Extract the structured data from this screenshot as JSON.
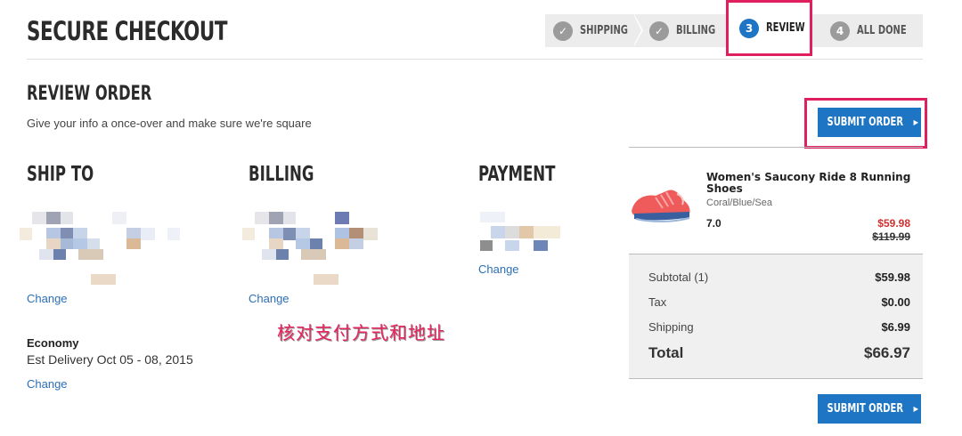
{
  "page": {
    "title": "SECURE CHECKOUT"
  },
  "steps": [
    {
      "label": "SHIPPING",
      "marker": "✓",
      "state": "done"
    },
    {
      "label": "BILLING",
      "marker": "✓",
      "state": "done"
    },
    {
      "label": "REVIEW",
      "marker": "3",
      "state": "active"
    },
    {
      "label": "ALL DONE",
      "marker": "4",
      "state": "pending"
    }
  ],
  "review": {
    "title": "REVIEW ORDER",
    "subtitle": "Give your info a once-over and make sure we're square",
    "submit_label": "SUBMIT ORDER"
  },
  "ship_to": {
    "title": "SHIP TO",
    "change_label": "Change"
  },
  "billing": {
    "title": "BILLING",
    "change_label": "Change"
  },
  "payment": {
    "title": "PAYMENT",
    "change_label": "Change"
  },
  "shipping_method": {
    "name": "Economy",
    "estimate": "Est Delivery Oct 05 - 08, 2015",
    "change_label": "Change"
  },
  "annotation": "核对支付方式和地址",
  "product": {
    "name": "Women's Saucony Ride 8 Running Shoes",
    "color": "Coral/Blue/Sea",
    "size": "7.0",
    "price": "$59.98",
    "original_price": "$119.99",
    "image_icon": "running-shoe-image"
  },
  "totals": {
    "subtotal_label": "Subtotal (1)",
    "subtotal": "$59.98",
    "tax_label": "Tax",
    "tax": "$0.00",
    "shipping_label": "Shipping",
    "shipping": "$6.99",
    "total_label": "Total",
    "total": "$66.97"
  },
  "colors": {
    "accent": "#1d75c3",
    "highlight": "#e0205e",
    "sale": "#d32f2f"
  }
}
